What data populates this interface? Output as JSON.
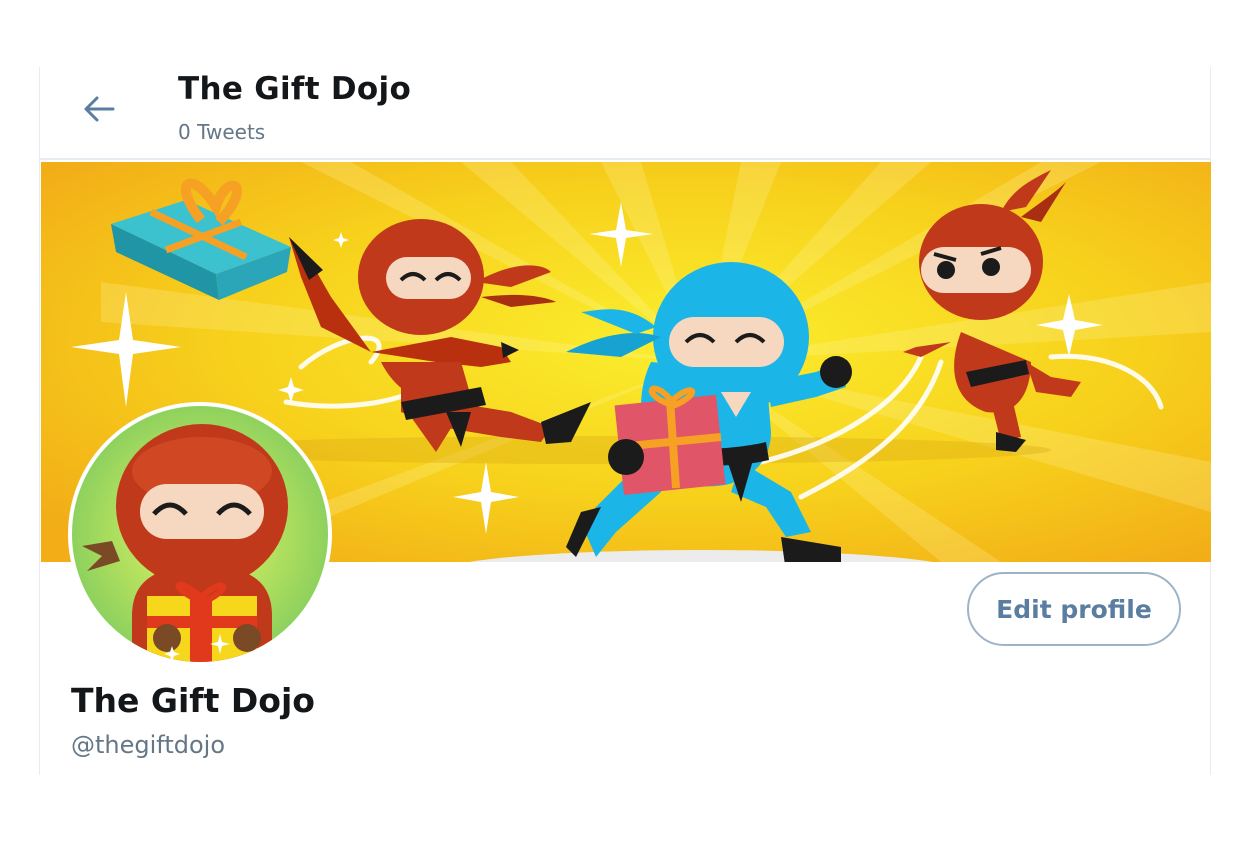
{
  "header": {
    "title": "The Gift Dojo",
    "tweet_count": "0 Tweets"
  },
  "profile": {
    "name": "The Gift Dojo",
    "handle": "@thegiftdojo",
    "edit_button_label": "Edit profile"
  },
  "icons": {
    "back": "arrow-left-icon"
  },
  "colors": {
    "accent": "#5a7da0",
    "banner_yellow": "#f7c616",
    "ninja_red": "#c0391b",
    "ninja_blue": "#1cb5e8",
    "gift_teal": "#2aa6b8",
    "gift_pink": "#e05668",
    "avatar_green": "#8ed16a",
    "secondary_text": "#657786"
  }
}
